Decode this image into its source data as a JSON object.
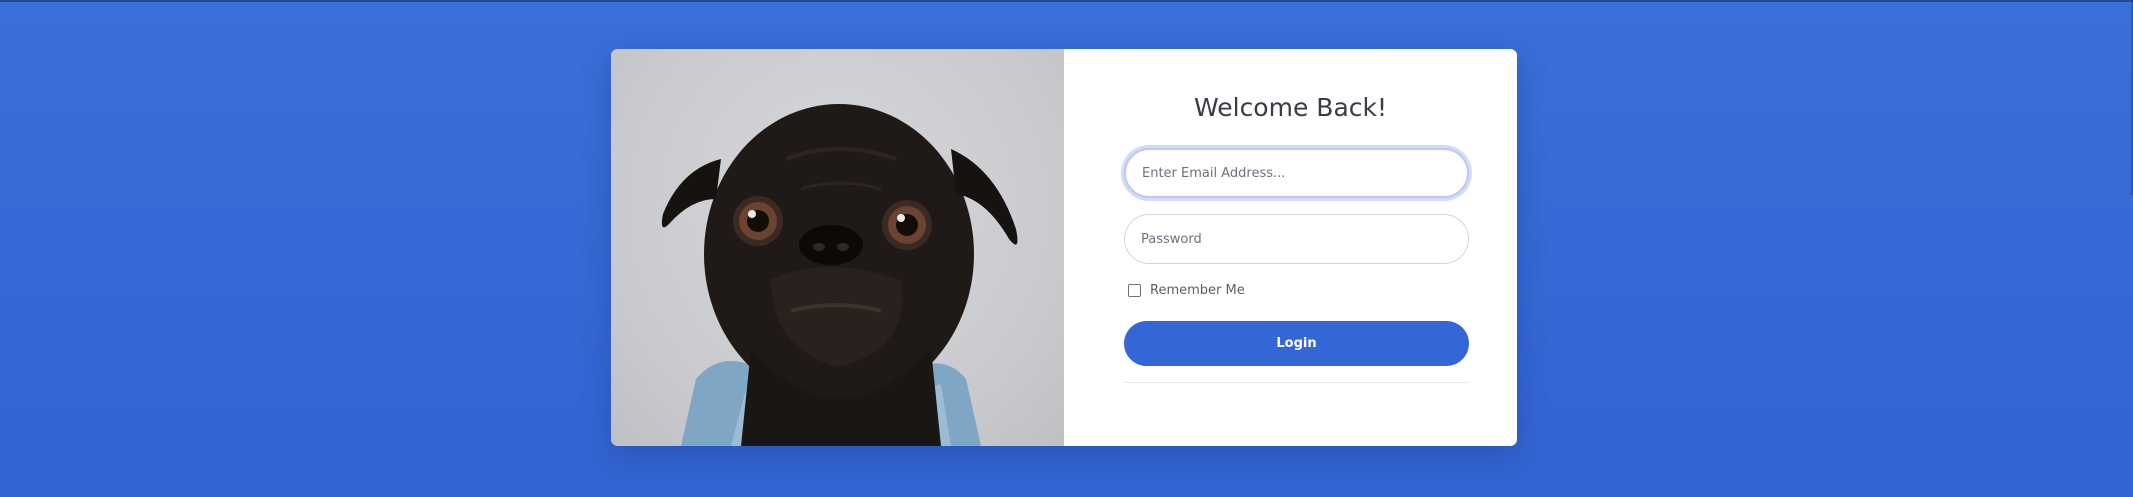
{
  "form": {
    "title": "Welcome Back!",
    "email_placeholder": "Enter Email Address...",
    "password_placeholder": "Password",
    "remember_label": "Remember Me",
    "login_label": "Login"
  },
  "colors": {
    "background": "#3467d6",
    "button": "#3467d6",
    "card": "#ffffff"
  },
  "image": {
    "subject": "pug-dog-photo"
  }
}
